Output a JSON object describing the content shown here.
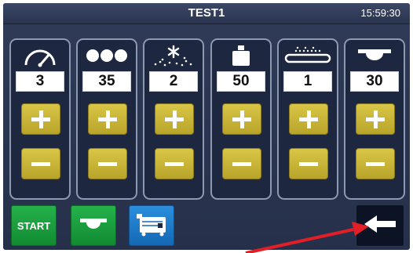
{
  "header": {
    "title": "TEST1",
    "clock": "15:59:30"
  },
  "panels": [
    {
      "icon": "speed-gauge-icon",
      "value": "3"
    },
    {
      "icon": "balls-icon",
      "value": "35"
    },
    {
      "icon": "spray-icon",
      "value": "2"
    },
    {
      "icon": "weight-icon",
      "value": "50"
    },
    {
      "icon": "conveyor-belt-icon",
      "value": "1"
    },
    {
      "icon": "roller-belt-icon",
      "value": "30"
    }
  ],
  "bottom_bar": {
    "start_label": "START",
    "belt_icon": "roller-belt-icon",
    "machine_icon": "machine-icon",
    "back_icon": "back-arrow-icon"
  },
  "colors": {
    "background": "#2f3b58",
    "panel": "#1e2740",
    "panel_border": "#8d99b1",
    "adjust_button": "#c9b53a",
    "start_green": "#1ea040",
    "machine_blue": "#1f7ac8",
    "annotation_arrow": "#e41e26"
  },
  "annotation": {
    "type": "red-arrow",
    "points_to": "back-button"
  }
}
